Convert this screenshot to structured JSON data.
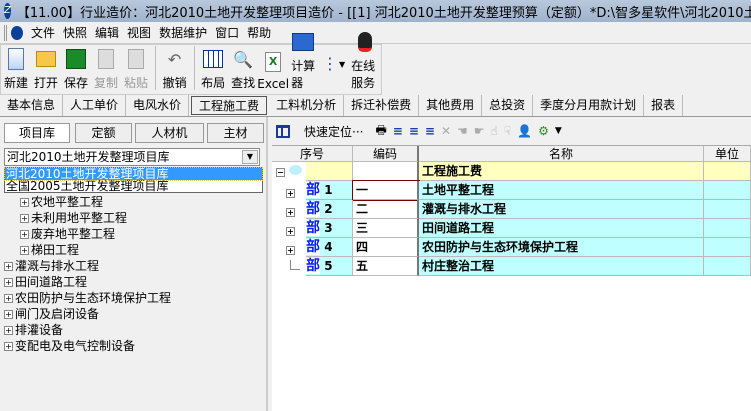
{
  "window": {
    "title": "【11.00】行业造价：河北2010土地开发整理项目造价 - [[1] 河北2010土地开发整理预算（定额）*D:\\智多星软件\\河北2010土地开发整理"
  },
  "menu": [
    "文件",
    "快照",
    "编辑",
    "视图",
    "数据维护",
    "窗口",
    "帮助"
  ],
  "toolbar": [
    {
      "label": "新建",
      "icon": "new-file-icon",
      "disabled": false
    },
    {
      "label": "打开",
      "icon": "open-folder-icon",
      "disabled": false
    },
    {
      "label": "保存",
      "icon": "save-icon",
      "disabled": false
    },
    {
      "label": "复制",
      "icon": "copy-icon",
      "disabled": true
    },
    {
      "label": "粘贴",
      "icon": "paste-icon",
      "disabled": true
    },
    {
      "label": "撤销",
      "icon": "undo-icon",
      "disabled": false
    },
    {
      "label": "布局",
      "icon": "layout-grid-icon",
      "disabled": false
    },
    {
      "label": "查找",
      "icon": "find-icon",
      "disabled": false
    },
    {
      "label": "Excel",
      "icon": "excel-icon",
      "disabled": false
    },
    {
      "label": "计算器",
      "icon": "calculator-icon",
      "disabled": false
    },
    {
      "label": "",
      "icon": "tree-structure-icon",
      "disabled": false
    },
    {
      "label": "在线服务",
      "icon": "qq-penguin-icon",
      "disabled": false
    }
  ],
  "tabs": [
    {
      "label": "基本信息"
    },
    {
      "label": "人工单价"
    },
    {
      "label": "电风水价"
    },
    {
      "label": "工程施工费",
      "active": true
    },
    {
      "label": "工料机分析"
    },
    {
      "label": "拆迁补偿费"
    },
    {
      "label": "其他费用"
    },
    {
      "label": "总投资"
    },
    {
      "label": "季度分月用款计划"
    },
    {
      "label": "报表"
    }
  ],
  "left": {
    "buttons": [
      "项目库",
      "定额",
      "人材机",
      "主材"
    ],
    "combo_value": "河北2010土地开发整理项目库",
    "combo_options": [
      "河北2010土地开发整理项目库",
      "全国2005土地开发整理项目库"
    ],
    "tree": [
      {
        "label": "农地平整工程",
        "level": 1
      },
      {
        "label": "未利用地平整工程",
        "level": 1
      },
      {
        "label": "废弃地平整工程",
        "level": 1
      },
      {
        "label": "梯田工程",
        "level": 1
      },
      {
        "label": "灌溉与排水工程",
        "level": 0
      },
      {
        "label": "田间道路工程",
        "level": 0
      },
      {
        "label": "农田防护与生态环境保护工程",
        "level": 0
      },
      {
        "label": "闸门及启闭设备",
        "level": 0
      },
      {
        "label": "排灌设备",
        "level": 0
      },
      {
        "label": "变配电及电气控制设备",
        "level": 0
      }
    ]
  },
  "right": {
    "quick_locate": "快速定位···",
    "columns": [
      "序号",
      "编码",
      "名称",
      "单位"
    ],
    "root": {
      "name": "工程施工费"
    },
    "rows": [
      {
        "type": "部",
        "seq": "1",
        "code": "一",
        "name": "土地平整工程"
      },
      {
        "type": "部",
        "seq": "2",
        "code": "二",
        "name": "灌溉与排水工程"
      },
      {
        "type": "部",
        "seq": "3",
        "code": "三",
        "name": "田间道路工程"
      },
      {
        "type": "部",
        "seq": "4",
        "code": "四",
        "name": "农田防护与生态环境保护工程"
      },
      {
        "type": "部",
        "seq": "5",
        "code": "五",
        "name": "村庄整治工程"
      }
    ],
    "colors": {
      "root_bg": "#ffffc0",
      "row_bg": "#bfffff",
      "type_color": "#0020ff"
    }
  }
}
